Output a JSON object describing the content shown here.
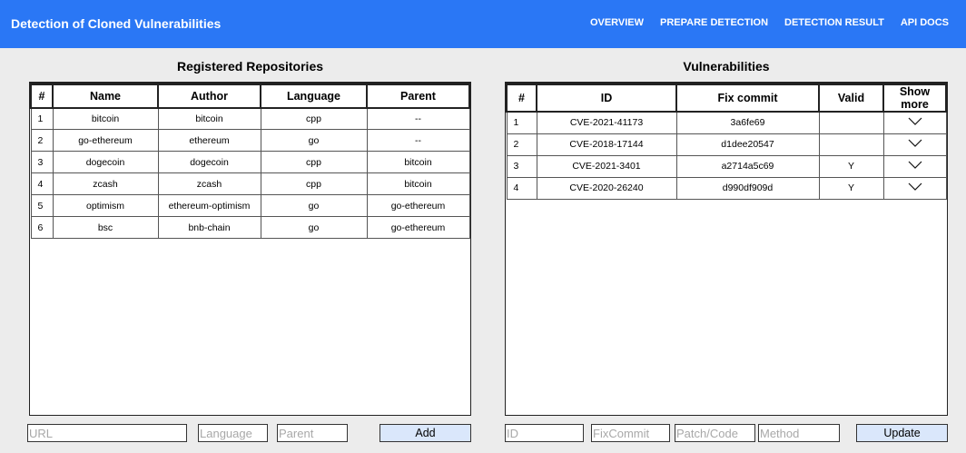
{
  "header": {
    "title": "Detection of Cloned Vulnerabilities",
    "nav": [
      "OVERVIEW",
      "PREPARE DETECTION",
      "DETECTION RESULT",
      "API DOCS"
    ]
  },
  "repositories": {
    "title": "Registered Repositories",
    "columns": [
      "#",
      "Name",
      "Author",
      "Language",
      "Parent"
    ],
    "rows": [
      [
        "1",
        "bitcoin",
        "bitcoin",
        "cpp",
        "--"
      ],
      [
        "2",
        "go-ethereum",
        "ethereum",
        "go",
        "--"
      ],
      [
        "3",
        "dogecoin",
        "dogecoin",
        "cpp",
        "bitcoin"
      ],
      [
        "4",
        "zcash",
        "zcash",
        "cpp",
        "bitcoin"
      ],
      [
        "5",
        "optimism",
        "ethereum-optimism",
        "go",
        "go-ethereum"
      ],
      [
        "6",
        "bsc",
        "bnb-chain",
        "go",
        "go-ethereum"
      ]
    ],
    "form": {
      "url_placeholder": "URL",
      "language_placeholder": "Language",
      "parent_placeholder": "Parent",
      "add_label": "Add"
    }
  },
  "vulnerabilities": {
    "title": "Vulnerabilities",
    "columns": [
      "#",
      "ID",
      "Fix commit",
      "Valid",
      "Show more"
    ],
    "rows": [
      [
        "1",
        "CVE-2021-41173",
        "3a6fe69",
        ""
      ],
      [
        "2",
        "CVE-2018-17144",
        "d1dee20547",
        ""
      ],
      [
        "3",
        "CVE-2021-3401",
        "a2714a5c69",
        "Y"
      ],
      [
        "4",
        "CVE-2020-26240",
        "d990df909d",
        "Y"
      ]
    ],
    "show_more_icon": "chevron-down-icon",
    "form": {
      "id_placeholder": "ID",
      "fixcommit_placeholder": "FixCommit",
      "patch_placeholder": "Patch/Code",
      "method_placeholder": "Method",
      "update_label": "Update"
    }
  },
  "colors": {
    "header_bg": "#2a77f5",
    "button_bg": "#dae7fb",
    "page_bg": "#ececec"
  }
}
